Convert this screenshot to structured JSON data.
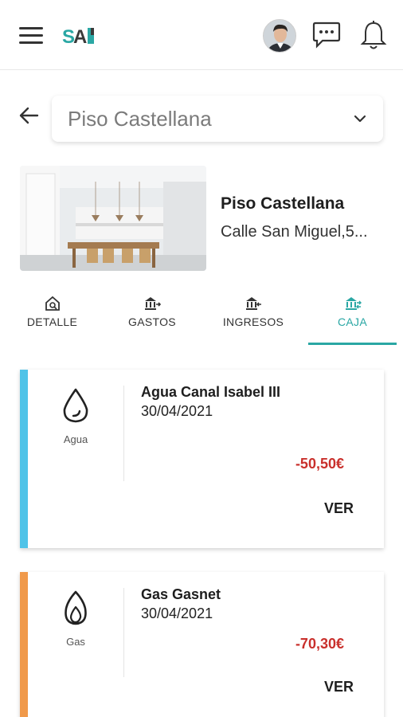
{
  "header": {
    "logo_text": "SAI",
    "icons": [
      "menu-icon",
      "chat-icon",
      "bell-icon"
    ]
  },
  "property_selector": {
    "selected": "Piso Castellana"
  },
  "property": {
    "name": "Piso Castellana",
    "address": "Calle San Miguel,5..."
  },
  "tabs": [
    {
      "label": "DETALLE",
      "icon": "house-search-icon",
      "active": false
    },
    {
      "label": "GASTOS",
      "icon": "bank-out-icon",
      "active": false
    },
    {
      "label": "INGRESOS",
      "icon": "bank-in-icon",
      "active": false
    },
    {
      "label": "CAJA",
      "icon": "bank-transfer-icon",
      "active": true
    }
  ],
  "transactions": [
    {
      "category": "Agua",
      "title": "Agua Canal Isabel III",
      "date": "30/04/2021",
      "amount": "-50,50€",
      "action": "VER",
      "color": "#4fc3e8"
    },
    {
      "category": "Gas",
      "title": "Gas Gasnet",
      "date": "30/04/2021",
      "amount": "-70,30€",
      "action": "VER",
      "color": "#f0994a"
    }
  ],
  "colors": {
    "accent": "#2aa7a4",
    "negative_amount": "#c9302c"
  }
}
